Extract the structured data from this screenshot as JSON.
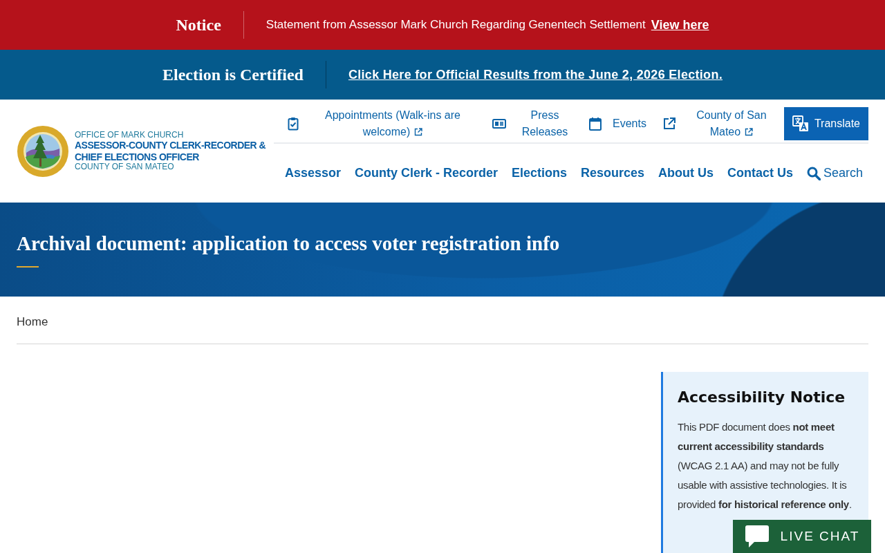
{
  "notice_bar": {
    "label": "Notice",
    "text": "Statement from Assessor Mark Church Regarding Genentech Settlement",
    "link": "View here"
  },
  "election_bar": {
    "label": "Election is Certified",
    "link": "Click Here for Official Results from the June 2, 2026 Election."
  },
  "header": {
    "logo_lines": [
      {
        "kind": "light",
        "text": "OFFICE OF MARK CHURCH"
      },
      {
        "kind": "bold",
        "text": "ASSESSOR-COUNTY CLERK-RECORDER &"
      },
      {
        "kind": "bold",
        "text": "CHIEF ELECTIONS OFFICER"
      },
      {
        "kind": "light",
        "text": "COUNTY OF SAN MATEO"
      }
    ],
    "utility_links": [
      {
        "kind": "appointments",
        "label": "Appointments (Walk-ins are welcome)",
        "external": true
      },
      {
        "kind": "press",
        "label": "Press Releases",
        "external": false
      },
      {
        "kind": "events",
        "label": "Events",
        "external": false
      },
      {
        "kind": "county",
        "label": "County of San Mateo",
        "external": true
      }
    ],
    "translate_button": "Translate",
    "nav": [
      "Assessor",
      "County Clerk - Recorder",
      "Elections",
      "Resources",
      "About Us",
      "Contact Us"
    ],
    "search": "Search"
  },
  "page_title": "Archival document: application to access voter registration info",
  "breadcrumb": [
    "Home"
  ],
  "accessibility_notice": {
    "title": "Accessibility Notice",
    "text": "This PDF document does **not meet current accessibility standards** (WCAG 2.1 AA) and may not be fully usable with assistive technologies. It is provided **for historical reference** **only**."
  },
  "live_chat": "LIVE CHAT"
}
